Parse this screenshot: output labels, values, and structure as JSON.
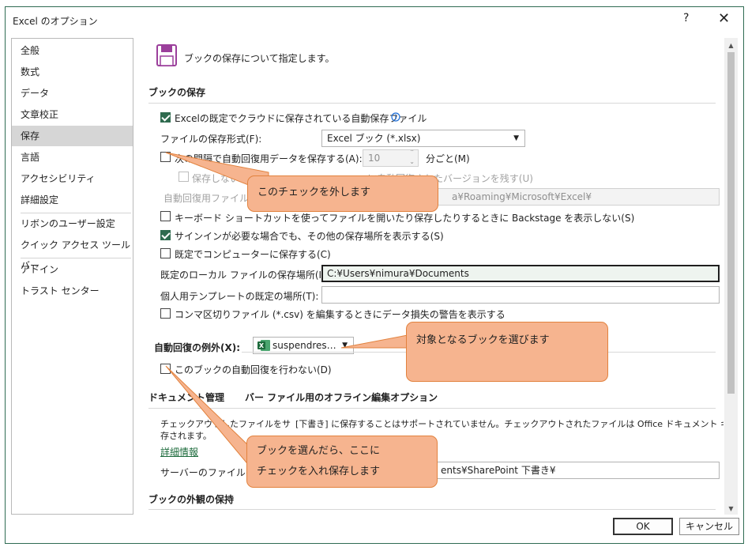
{
  "window": {
    "title": "Excel のオプション",
    "help": "?",
    "close": "✕"
  },
  "sidebar": {
    "items": [
      "全般",
      "数式",
      "データ",
      "文章校正",
      "保存",
      "言語",
      "アクセシビリティ",
      "詳細設定",
      "リボンのユーザー設定",
      "クイック アクセス ツール バー",
      "アドイン",
      "トラスト センター"
    ],
    "selected": "保存"
  },
  "main": {
    "intro": "ブックの保存について指定します。",
    "section_save": "ブックの保存",
    "autosave_cloud": {
      "label": "Excelの既定でクラウドに保存されている自動保存ファイル",
      "checked": true
    },
    "file_format": {
      "label": "ファイルの保存形式(F):",
      "value": "Excel ブック (*.xlsx)"
    },
    "autorecover_interval": {
      "label": "次の間隔で自動回復用データを保存する(A):",
      "value": "10",
      "unit": "分ごと(M)",
      "checked": false
    },
    "keep_last": {
      "label_start": "保存しないで終",
      "label_end": "に自動回復されたバージョンを残す(U)",
      "checked": false
    },
    "autorecover_location": {
      "label": "自動回復用ファイルの場",
      "value": "a¥Roaming¥Microsoft¥Excel¥"
    },
    "backstage": {
      "label": "キーボード ショートカットを使ってファイルを開いたり保存したりするときに Backstage を表示しない(S)",
      "checked": false
    },
    "signin": {
      "label": "サインインが必要な場合でも、その他の保存場所を表示する(S)",
      "checked": true
    },
    "save_to_computer": {
      "label": "既定でコンピューターに保存する(C)",
      "checked": false
    },
    "default_local": {
      "label": "既定のローカル ファイルの保存場所(I):",
      "value": "C:¥Users¥nimura¥Documents"
    },
    "template_location": {
      "label": "個人用テンプレートの既定の場所(T):",
      "value": ""
    },
    "csv_warning": {
      "label": "コンマ区切りファイル (*.csv) を編集するときにデータ損失の警告を表示する",
      "checked": false
    },
    "exceptions": {
      "label": "自動回復の例外(X):",
      "workbook": "suspendres…"
    },
    "disable_autorecover": {
      "label": "このブックの自動回復を行わない(D)",
      "checked": false
    },
    "offline_section": {
      "part1": "ドキュメント管理",
      "part2": "バー ファイル用のオフライン編集オプション"
    },
    "offline_text": {
      "line1_a": "チェックアウトしたファイルをサ",
      "line1_b": "[下書き] に保存することはサポートされていません。チェックアウトされたファイルは Office ドキュメント キャッシュに保",
      "line2": "存されます。"
    },
    "more_info": "詳細情報",
    "server_drafts": {
      "label": "サーバーのファイルの下書",
      "value": "ents¥SharePoint 下書き¥"
    },
    "section_appearance": "ブックの外観の保持"
  },
  "buttons": {
    "ok": "OK",
    "cancel": "キャンセル"
  },
  "callouts": {
    "uncheck": "このチェックを外します",
    "select_book": "対象となるブックを選びます",
    "check_save_l1": "ブックを選んだら、ここに",
    "check_save_l2": "チェックを入れ保存します"
  },
  "colors": {
    "accent": "#2f6b4f",
    "callout_fill": "#f6b48f",
    "callout_border": "#e2823e"
  }
}
